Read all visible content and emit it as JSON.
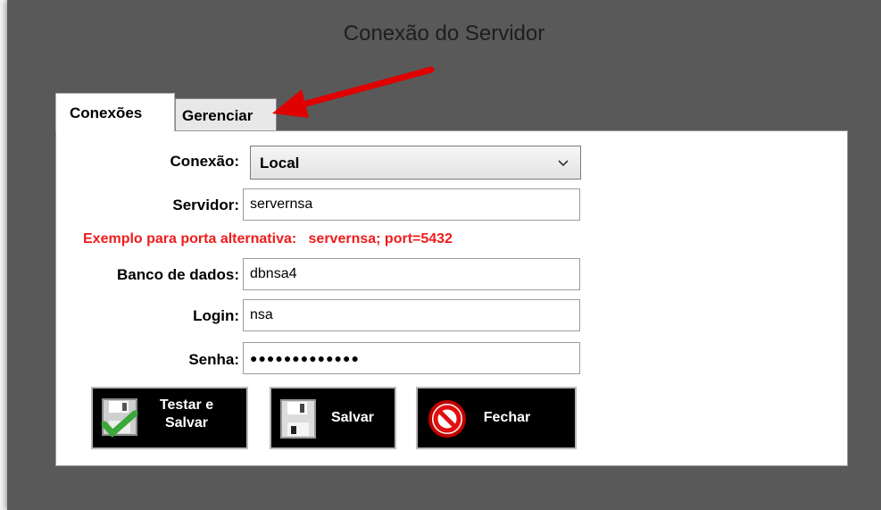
{
  "window": {
    "title": "Conexão do Servidor"
  },
  "tabs": [
    {
      "label": "Conexões",
      "active": true
    },
    {
      "label": "Gerenciar",
      "active": false
    }
  ],
  "form": {
    "connection": {
      "label": "Conexão:",
      "value": "Local"
    },
    "server": {
      "label": "Servidor:",
      "value": "servernsa"
    },
    "hint": "Exemplo para porta alternativa:   servernsa; port=5432",
    "database": {
      "label": "Banco de dados:",
      "value": "dbnsa4"
    },
    "login": {
      "label": "Login:",
      "value": "nsa"
    },
    "password": {
      "label": "Senha:",
      "value": "●●●●●●●●●●●●●"
    }
  },
  "buttons": {
    "test_save_line1": "Testar e",
    "test_save_line2": "Salvar",
    "save": "Salvar",
    "close": "Fechar"
  },
  "colors": {
    "hint": "#ee1c1c",
    "arrow": "#e00000",
    "window_bg": "#595959",
    "button_bg": "#000000"
  },
  "icons": [
    "save-check-icon",
    "floppy-disk-icon",
    "no-entry-icon",
    "chevron-down-icon",
    "red-arrow-annotation"
  ]
}
